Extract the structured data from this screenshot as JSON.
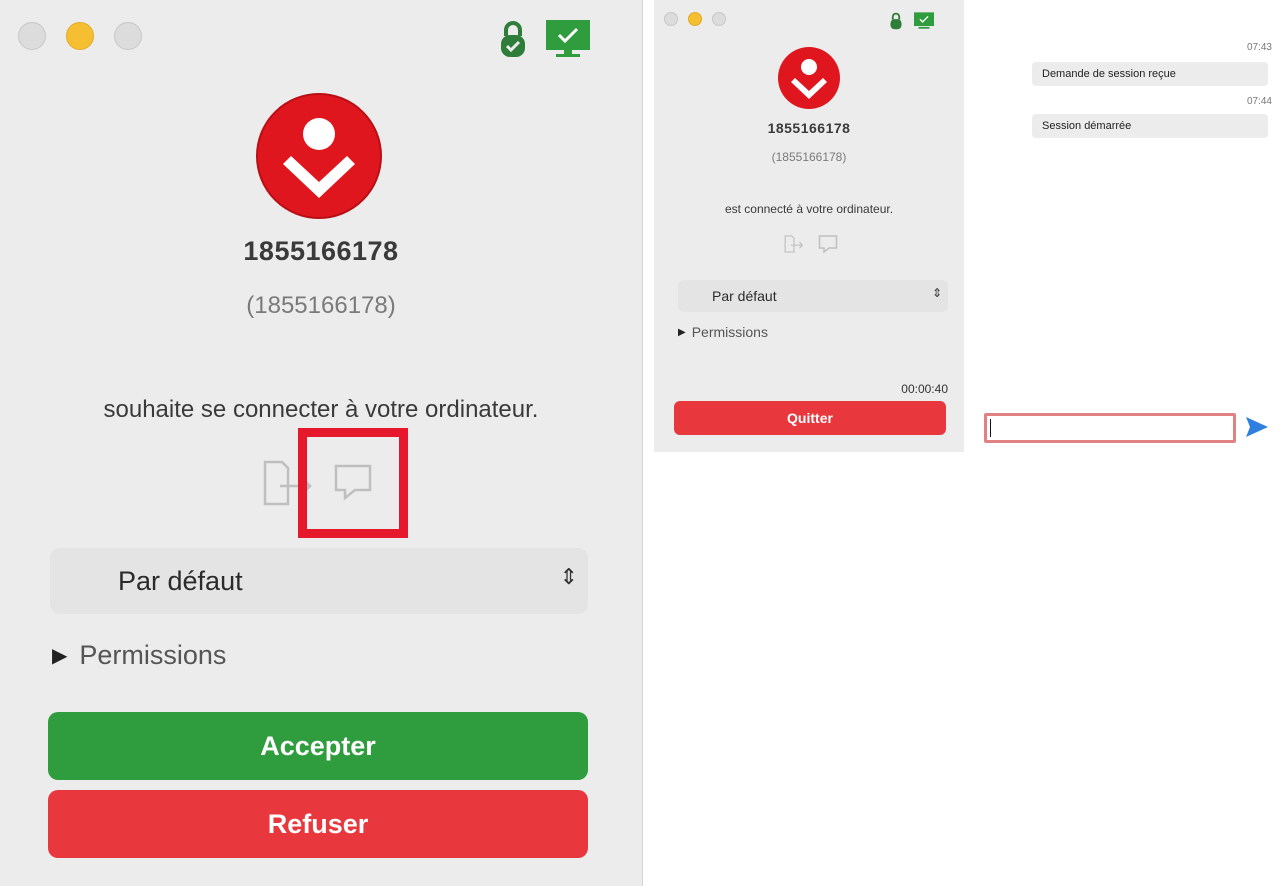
{
  "request_window": {
    "peer_id": "1855166178",
    "peer_sub": "(1855166178)",
    "message": "souhaite se connecter à votre ordinateur.",
    "profile": "Par défaut",
    "permissions_label": "Permissions",
    "accept_label": "Accepter",
    "refuse_label": "Refuser"
  },
  "session_window": {
    "peer_id": "1855166178",
    "peer_sub": "(1855166178)",
    "message": "est connecté à votre ordinateur.",
    "profile": "Par défaut",
    "permissions_label": "Permissions",
    "timer": "00:00:40",
    "quit_label": "Quitter",
    "chat": {
      "messages": [
        {
          "time": "07:43",
          "text": "Demande de session reçue"
        },
        {
          "time": "07:44",
          "text": "Session démarrée"
        }
      ],
      "input_value": ""
    }
  },
  "colors": {
    "accept": "#2f9d3e",
    "refuse": "#e8373d",
    "highlight": "#e6182c",
    "status_green": "#2f9d3e"
  },
  "icons": [
    "lock-icon",
    "monitor-check-icon",
    "file-transfer-icon",
    "chat-icon",
    "send-icon"
  ]
}
